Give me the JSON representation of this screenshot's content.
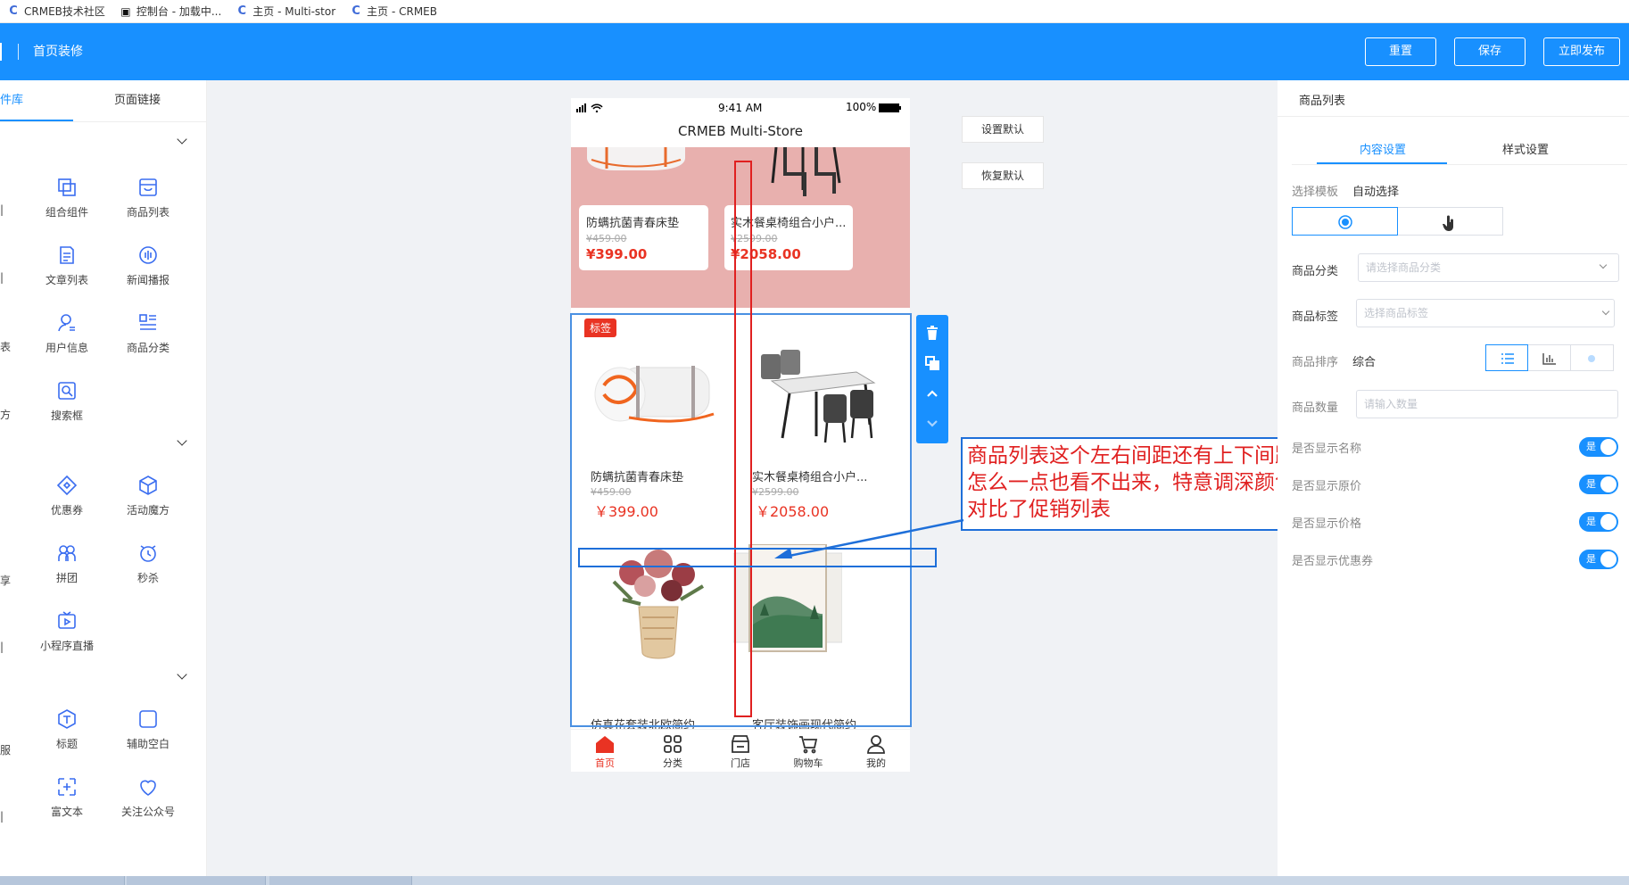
{
  "browser_tabs": [
    {
      "label": "CRMEB技术社区",
      "icon": "crmeb-c-icon"
    },
    {
      "label": "控制台 - 加载中...",
      "icon": "console-icon"
    },
    {
      "label": "主页 - Multi-stor",
      "icon": "crmeb-c-icon"
    },
    {
      "label": "主页 - CRMEB",
      "icon": "crmeb-c-icon"
    }
  ],
  "topbar": {
    "title": "首页装修",
    "buttons": {
      "reset": "重置",
      "save": "保存",
      "publish": "立即发布"
    },
    "accent": "#1890ff"
  },
  "left_panel": {
    "tabs": {
      "library": "件库",
      "links": "页面链接"
    },
    "components": {
      "combo": "组合组件",
      "product_list": "商品列表",
      "article_list": "文章列表",
      "news": "新闻播报",
      "user_info": "用户信息",
      "product_category": "商品分类",
      "search": "搜索框",
      "coupon": "优惠券",
      "magic": "活动魔方",
      "group_buy": "拼团",
      "flash_sale": "秒杀",
      "live": "小程序直播",
      "title": "标题",
      "spacer": "辅助空白",
      "rich_text": "富文本",
      "follow_account": "关注公众号"
    },
    "edge_chars": [
      "|",
      "|",
      "表",
      "方",
      "享",
      "|",
      "服",
      "|"
    ]
  },
  "canvas": {
    "default_btns": {
      "set_default": "设置默认",
      "restore_default": "恢复默认"
    },
    "annotation": "商品列表这个左右间距还有上下间距怎么一点也看不出来，特意调深颜色对比了促销列表"
  },
  "phone": {
    "status": {
      "time": "9:41 AM",
      "battery": "100%"
    },
    "app_title": "CRMEB Multi-Store",
    "promo_products": [
      {
        "name": "防螨抗菌青春床垫",
        "old": "¥459.00",
        "price": "¥399.00"
      },
      {
        "name": "实木餐桌椅组合小户...",
        "old": "¥2599.00",
        "price": "¥2058.00"
      }
    ],
    "list_badge": "标签",
    "list_products": [
      {
        "name": "防螨抗菌青春床垫",
        "old": "¥459.00",
        "price": "￥399.00"
      },
      {
        "name": "实木餐桌椅组合小户...",
        "old": "¥2599.00",
        "price": "￥2058.00"
      }
    ],
    "cut_names": [
      "仿真花套装北欧简约",
      "客厅装饰画现代简约"
    ],
    "nav": [
      "首页",
      "分类",
      "门店",
      "购物车",
      "我的"
    ]
  },
  "right_panel": {
    "title": "商品列表",
    "tabs": {
      "content": "内容设置",
      "style": "样式设置"
    },
    "template_label": "选择模板",
    "template_value": "自动选择",
    "category_label": "商品分类",
    "category_placeholder": "请选择商品分类",
    "tag_label": "商品标签",
    "tag_placeholder": "选择商品标签",
    "sort_label": "商品排序",
    "sort_value": "综合",
    "count_label": "商品数量",
    "count_placeholder": "请输入数量",
    "toggles": [
      {
        "label": "是否显示名称",
        "state": "是"
      },
      {
        "label": "是否显示原价",
        "state": "是"
      },
      {
        "label": "是否显示价格",
        "state": "是"
      },
      {
        "label": "是否显示优惠券",
        "state": "是"
      }
    ]
  }
}
